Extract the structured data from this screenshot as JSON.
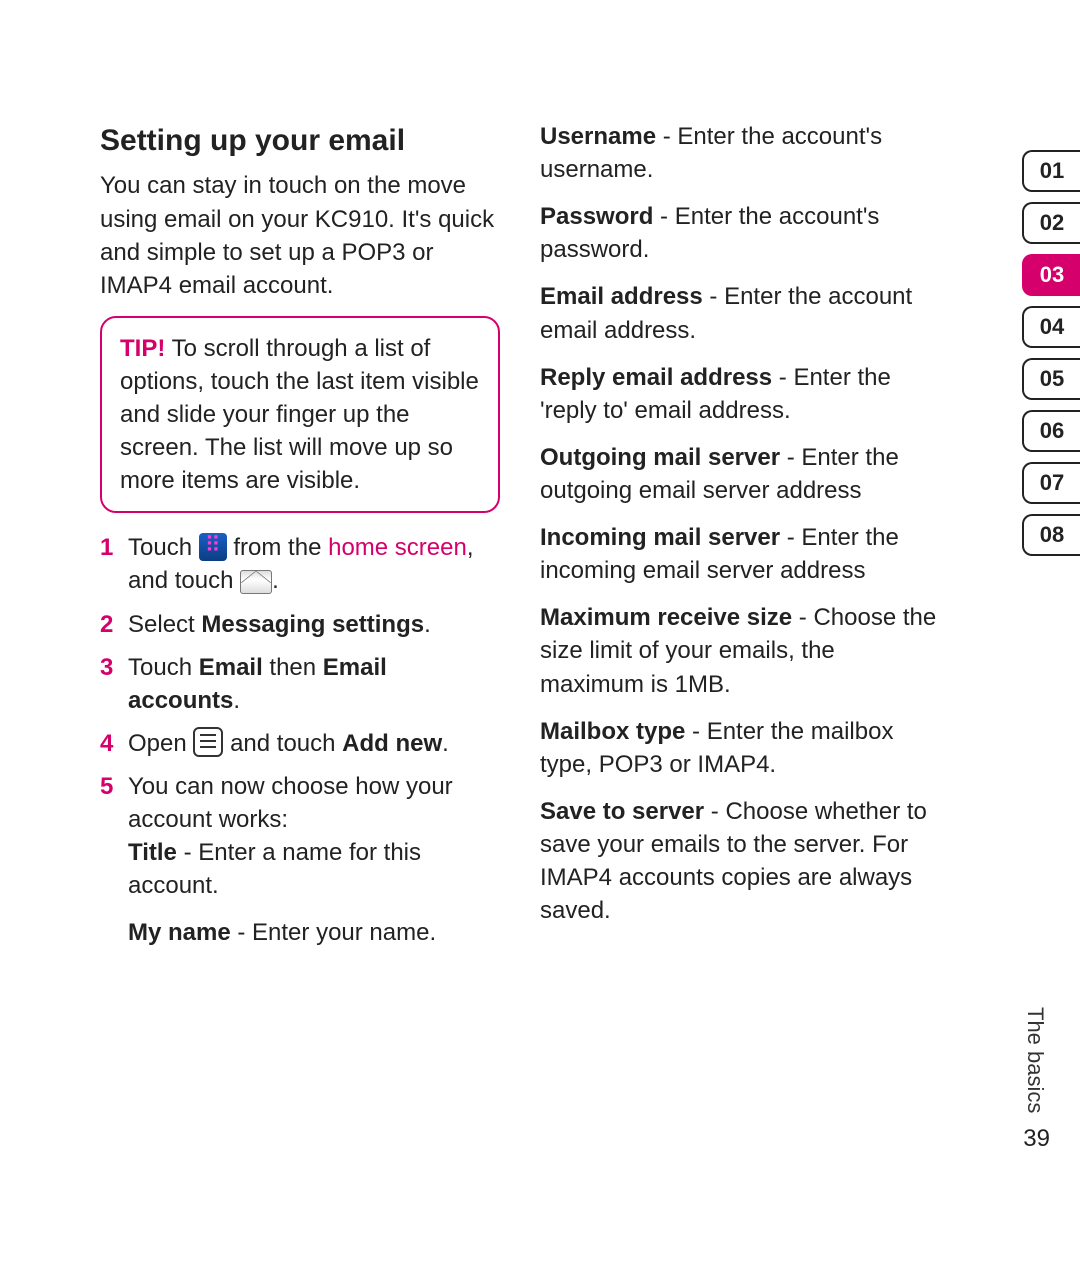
{
  "heading": "Setting up your email",
  "intro": "You can stay in touch on the move using email on your KC910. It's quick and simple to set up a POP3 or IMAP4 email account.",
  "tip": {
    "label": "TIP!",
    "text": " To scroll through a list of options, touch the last item visible and slide your finger up the screen. The list will move up so more items are visible."
  },
  "steps": {
    "s1a": "Touch ",
    "s1b": " from the ",
    "s1c": "home screen",
    "s1d": ", and touch ",
    "s1e": ".",
    "s2a": "Select ",
    "s2b": "Messaging settings",
    "s2c": ".",
    "s3a": "Touch ",
    "s3b": "Email",
    "s3c": " then ",
    "s3d": "Email accounts",
    "s3e": ".",
    "s4a": "Open ",
    "s4b": " and touch ",
    "s4c": "Add new",
    "s4d": ".",
    "s5": "You can now choose how your account works:"
  },
  "subfields_col1": [
    {
      "label": "Title",
      "desc": " - Enter a name for this account."
    },
    {
      "label": "My name",
      "desc": " - Enter your name."
    }
  ],
  "fields_col2": [
    {
      "label": "Username",
      "desc": " - Enter the account's username."
    },
    {
      "label": "Password",
      "desc": " - Enter the account's password."
    },
    {
      "label": "Email address",
      "desc": " - Enter the account email address."
    },
    {
      "label": "Reply email address",
      "desc": " - Enter the 'reply to' email address."
    },
    {
      "label": "Outgoing mail server",
      "desc": " - Enter the outgoing email server address"
    },
    {
      "label": "Incoming mail server",
      "desc": " - Enter the incoming email server address"
    },
    {
      "label": "Maximum receive size",
      "desc": " - Choose the size limit of your emails, the maximum is 1MB."
    },
    {
      "label": "Mailbox type",
      "desc": " - Enter the mailbox type, POP3 or IMAP4."
    },
    {
      "label": "Save to server",
      "desc": " - Choose whether to save your emails to the server. For IMAP4 accounts copies are always saved."
    }
  ],
  "sidebar": {
    "tabs": [
      "01",
      "02",
      "03",
      "04",
      "05",
      "06",
      "07",
      "08"
    ],
    "active_index": 2
  },
  "footer": {
    "section": "The basics",
    "page": "39"
  }
}
